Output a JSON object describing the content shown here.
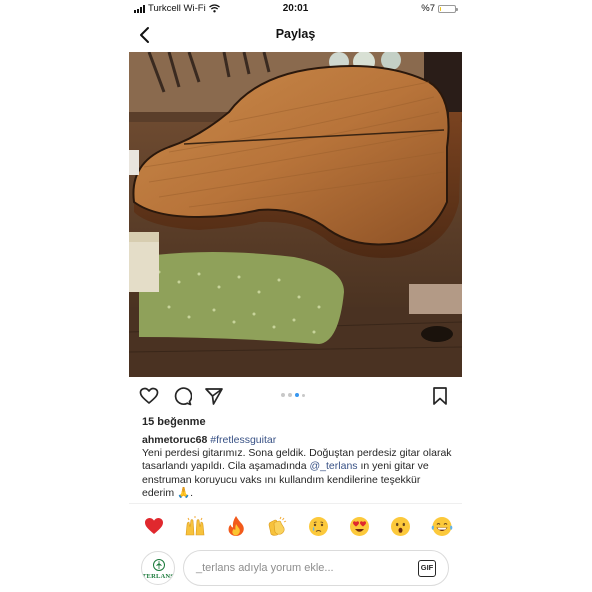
{
  "status_bar": {
    "carrier": "Turkcell Wi-Fi",
    "time": "20:01",
    "battery": "%7",
    "battery_level": 0.07
  },
  "header": {
    "title": "Paylaş",
    "back_icon": "chevron-left-icon"
  },
  "post": {
    "image_alt": "acoustic guitar back on workbench",
    "carousel": {
      "count": 4,
      "active_index": 2
    },
    "likes": "15 beğenme",
    "caption": {
      "username": "ahmetoruc68",
      "hashtag": "#fretlessguitar",
      "text_1": "Yeni perdesi gitarımız. Sona geldik. Doğuştan perdesiz gitar olarak tasarlandı yapıldı. Cila aşamadında ",
      "mention": "@_terlans",
      "text_2": " ın yeni gitar ve enstruman koruyucu vaks ını kullandım kendilerine teşekkür ederim 🙏."
    }
  },
  "actions": {
    "like_icon": "heart-icon",
    "comment_icon": "comment-icon",
    "share_icon": "send-icon",
    "save_icon": "bookmark-icon"
  },
  "emoji_bar": [
    "❤️",
    "🙌",
    "🔥",
    "👏",
    "😢",
    "😍",
    "😮",
    "😂"
  ],
  "comment": {
    "avatar_label": "TERLANS",
    "placeholder": "_terlans adıyla yorum ekle...",
    "gif_label": "GIF"
  },
  "colors": {
    "link": "#385185",
    "dot_active": "#3897f0",
    "battery": "#f0c419"
  }
}
